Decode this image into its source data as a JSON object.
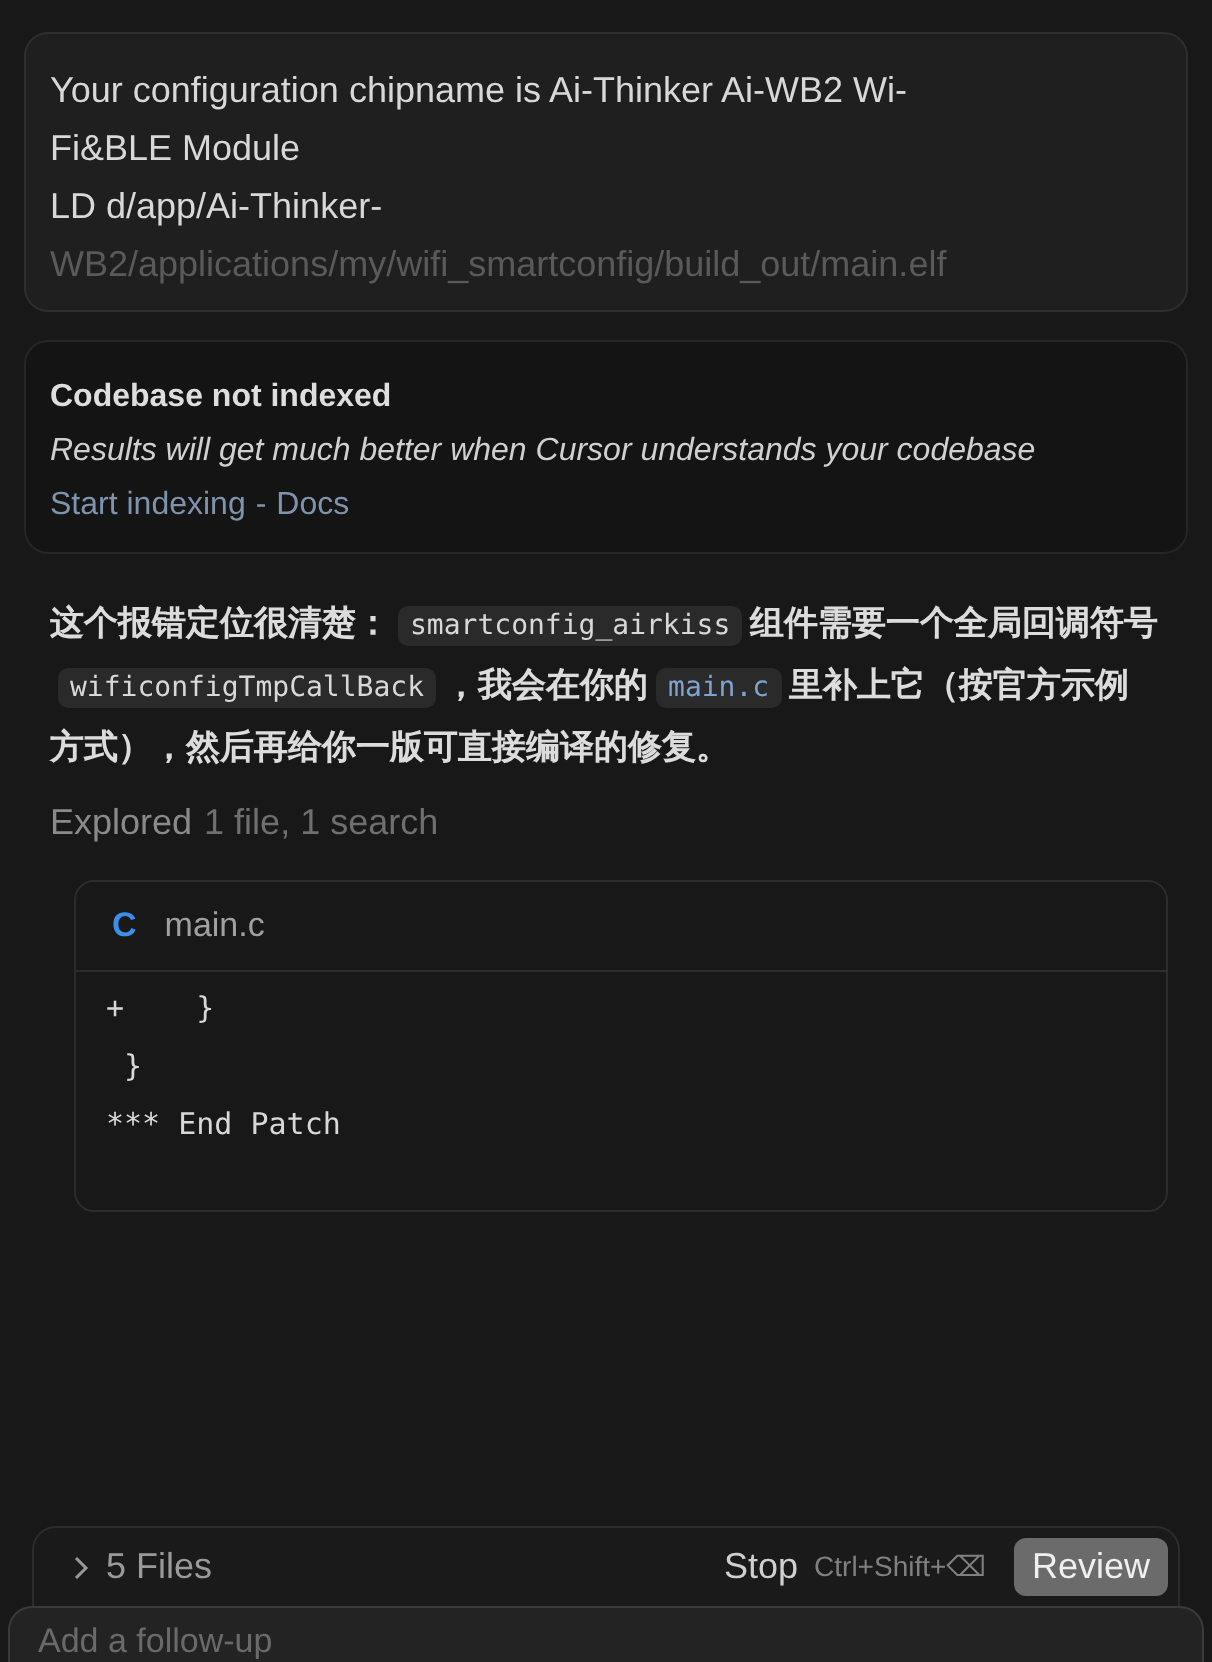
{
  "output_card": {
    "lines": [
      "Your configuration chipname is Ai-Thinker Ai-WB2 Wi-",
      "Fi&BLE Module",
      "LD d/app/Ai-Thinker-",
      "WB2/applications/my/wifi_smartconfig/build_out/main.elf"
    ]
  },
  "index_notice": {
    "title": "Codebase not indexed",
    "message": "Results will get much better when Cursor understands your codebase",
    "action": "Start indexing",
    "separator": "-",
    "link": "Docs"
  },
  "reply": [
    {
      "kind": "text",
      "text": "这个报错定位很清楚："
    },
    {
      "kind": "code",
      "text": "smartconfig_airkiss"
    },
    {
      "kind": "text",
      "text": "组件需要一个全局回调符号"
    },
    {
      "kind": "code",
      "text": "wificonfigTmpCallBack"
    },
    {
      "kind": "text",
      "text": "，我会在你的"
    },
    {
      "kind": "link",
      "text": "main.c"
    },
    {
      "kind": "text",
      "text": "里补上它（按官方示例方式），然后再给你一版可直接编译的修复。"
    }
  ],
  "explored": {
    "label": "Explored",
    "detail": "1 file, 1 search"
  },
  "code_file": {
    "icon": "C",
    "name": "main.c",
    "lines": [
      "+    }",
      " }",
      "*** End Patch"
    ]
  },
  "changes_bar": {
    "files": "5 Files",
    "stop": "Stop",
    "shortcut": "Ctrl+Shift+⌫",
    "review": "Review"
  },
  "composer": {
    "placeholder": "Add a follow-up"
  }
}
